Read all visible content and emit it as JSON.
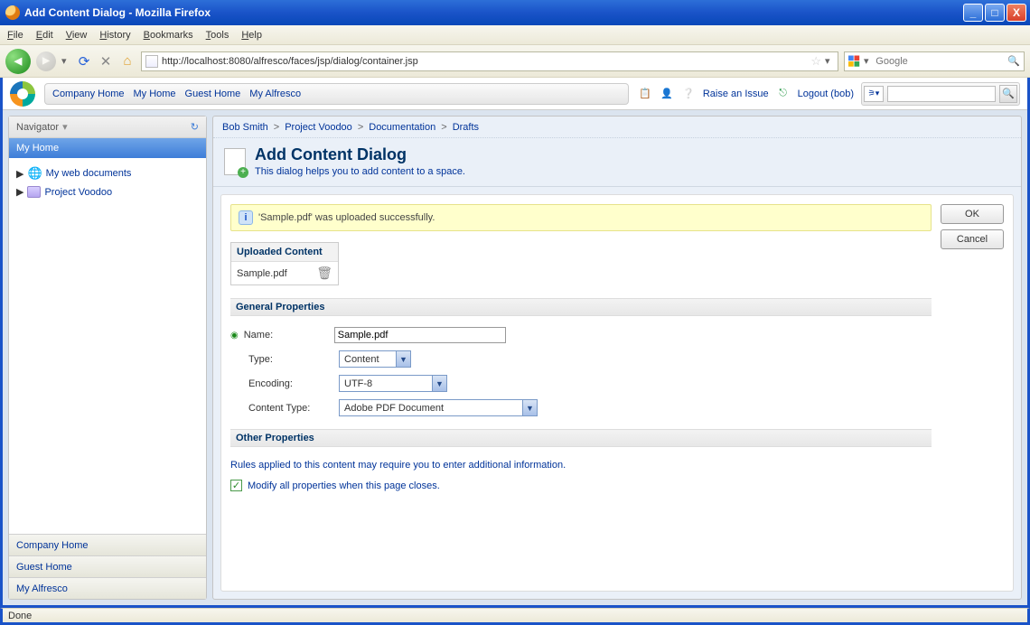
{
  "window": {
    "title": "Add Content Dialog - Mozilla Firefox"
  },
  "menubar": [
    "File",
    "Edit",
    "View",
    "History",
    "Bookmarks",
    "Tools",
    "Help"
  ],
  "toolbar": {
    "url": "http://localhost:8080/alfresco/faces/jsp/dialog/container.jsp",
    "search_placeholder": "Google"
  },
  "header_nav": [
    "Company Home",
    "My Home",
    "Guest Home",
    "My Alfresco"
  ],
  "header_right": {
    "raise": "Raise an Issue",
    "logout": "Logout (bob)"
  },
  "sidebar": {
    "title": "Navigator",
    "band": "My Home",
    "tree": [
      {
        "label": "My web documents",
        "kind": "globe"
      },
      {
        "label": "Project Voodoo",
        "kind": "folder"
      }
    ],
    "bottom": [
      "Company Home",
      "Guest Home",
      "My Alfresco"
    ]
  },
  "breadcrumbs": [
    "Bob Smith",
    "Project Voodoo",
    "Documentation",
    "Drafts"
  ],
  "page": {
    "title": "Add Content Dialog",
    "subtitle": "This dialog helps you to add content to a space."
  },
  "flash": "'Sample.pdf' was uploaded successfully.",
  "uploaded": {
    "heading": "Uploaded Content",
    "file": "Sample.pdf"
  },
  "sections": {
    "general": "General Properties",
    "other": "Other Properties"
  },
  "form": {
    "name_label": "Name:",
    "name_value": "Sample.pdf",
    "type_label": "Type:",
    "type_value": "Content",
    "encoding_label": "Encoding:",
    "encoding_value": "UTF-8",
    "ctype_label": "Content Type:",
    "ctype_value": "Adobe PDF Document"
  },
  "other_hint": "Rules applied to this content may require you to enter additional information.",
  "modify_label": "Modify all properties when this page closes.",
  "buttons": {
    "ok": "OK",
    "cancel": "Cancel"
  },
  "status": "Done"
}
